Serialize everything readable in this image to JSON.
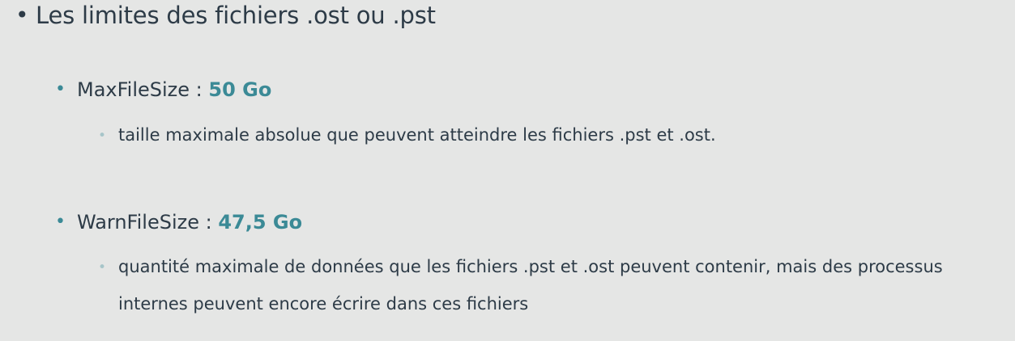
{
  "level1": {
    "bullet": "•",
    "text": "Les limites des fichiers .ost ou .pst"
  },
  "items": [
    {
      "bullet": "•",
      "name": "MaxFileSize",
      "separator": " : ",
      "value": "50 Go",
      "sub_bullet": "•",
      "description": "taille maximale absolue que peuvent atteindre les fichiers .pst et .ost."
    },
    {
      "bullet": "•",
      "name": "WarnFileSize",
      "separator": " : ",
      "value": "47,5 Go",
      "sub_bullet": "•",
      "description": "quantité maximale de données que les fichiers .pst et .ost peuvent contenir, mais des processus internes peuvent encore écrire dans ces fichiers"
    }
  ],
  "colors": {
    "background": "#e5e6e5",
    "text": "#2d3b47",
    "accent": "#3b8a96",
    "sub_bullet": "#a7c5c9"
  }
}
